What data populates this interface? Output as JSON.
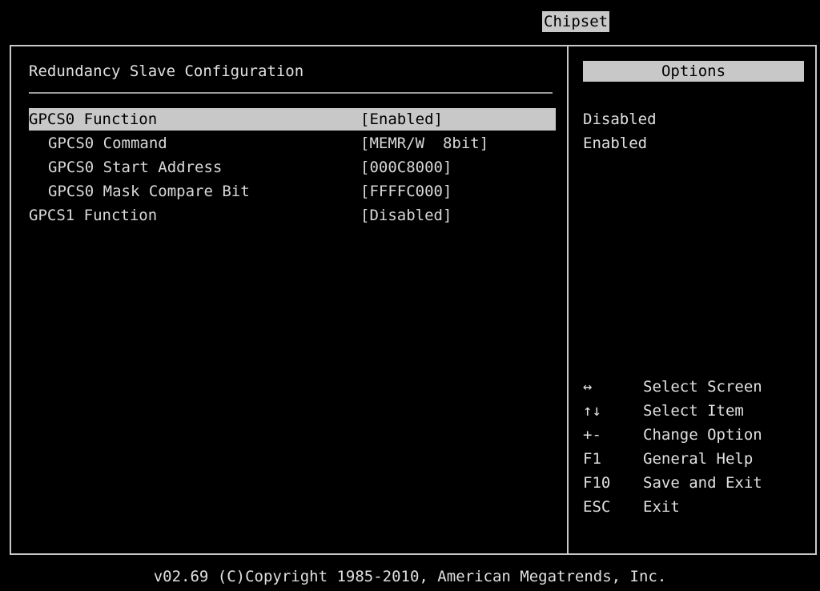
{
  "header": {
    "active_tab": "Chipset"
  },
  "main": {
    "title": "Redundancy Slave Configuration",
    "items": [
      {
        "label": "GPCS0 Function",
        "value": "[Enabled]"
      },
      {
        "label": "GPCS0 Command",
        "value": "[MEMR/W  8bit]"
      },
      {
        "label": "GPCS0 Start Address",
        "value": "[000C8000]"
      },
      {
        "label": "GPCS0 Mask Compare Bit",
        "value": "[FFFFC000]"
      },
      {
        "label": "GPCS1 Function",
        "value": "[Disabled]"
      }
    ]
  },
  "options": {
    "header": "Options",
    "items": [
      "Disabled",
      "Enabled"
    ]
  },
  "help": [
    {
      "key": "↔",
      "desc": "Select Screen"
    },
    {
      "key": "↑↓",
      "desc": "Select Item"
    },
    {
      "key": "+-",
      "desc": "Change Option"
    },
    {
      "key": "F1",
      "desc": "General Help"
    },
    {
      "key": "F10",
      "desc": "Save and Exit"
    },
    {
      "key": "ESC",
      "desc": "Exit"
    }
  ],
  "footer": {
    "text": "v02.69 (C)Copyright 1985-2010, American Megatrends, Inc."
  },
  "colors": {
    "background": "#000000",
    "highlight": "#c8c8c8",
    "text": "#d8d8d8"
  }
}
